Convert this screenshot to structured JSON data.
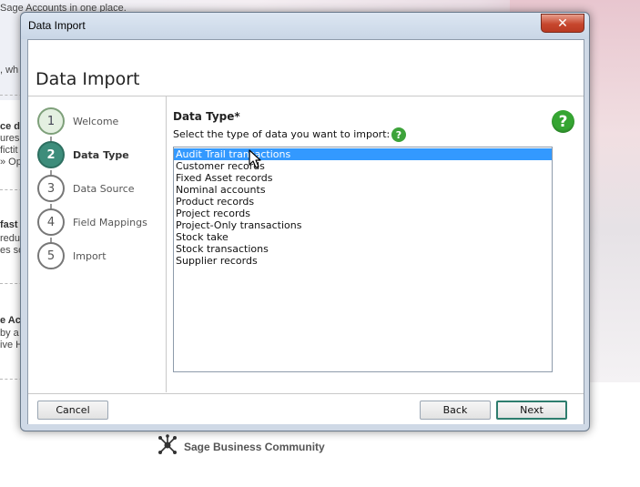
{
  "background": {
    "lines": [
      "Sage Accounts in one place.",
      ", wh",
      "ce d",
      "ures",
      " fictit",
      "» Op",
      "fast",
      "redu",
      "es so",
      "e Acc",
      " by a",
      "ive H"
    ],
    "community_label": "Sage Business Community",
    "community_icon": "network-icon"
  },
  "window": {
    "title": "Data Import",
    "close_glyph": "✕",
    "header_title": "Data Import",
    "steps": [
      {
        "number": "1",
        "label": "Welcome",
        "state": "done"
      },
      {
        "number": "2",
        "label": "Data Type",
        "state": "active"
      },
      {
        "number": "3",
        "label": "Data Source",
        "state": "pending"
      },
      {
        "number": "4",
        "label": "Field Mappings",
        "state": "pending"
      },
      {
        "number": "5",
        "label": "Import",
        "state": "pending"
      }
    ],
    "content": {
      "field_title": "Data Type*",
      "field_description": "Select the type of data you want to import:",
      "help_glyph": "?",
      "list_items": [
        "Audit Trail transactions",
        "Customer records",
        "Fixed Asset records",
        "Nominal accounts",
        "Product records",
        "Project records",
        "Project-Only transactions",
        "Stock take",
        "Stock transactions",
        "Supplier records"
      ],
      "selected_item": "Audit Trail transactions"
    },
    "footer": {
      "cancel_label": "Cancel",
      "back_label": "Back",
      "next_label": "Next"
    }
  },
  "colors": {
    "accent": "#3d8d7b",
    "selection": "#3399ff",
    "help": "#35a532",
    "close": "#c7472e"
  }
}
